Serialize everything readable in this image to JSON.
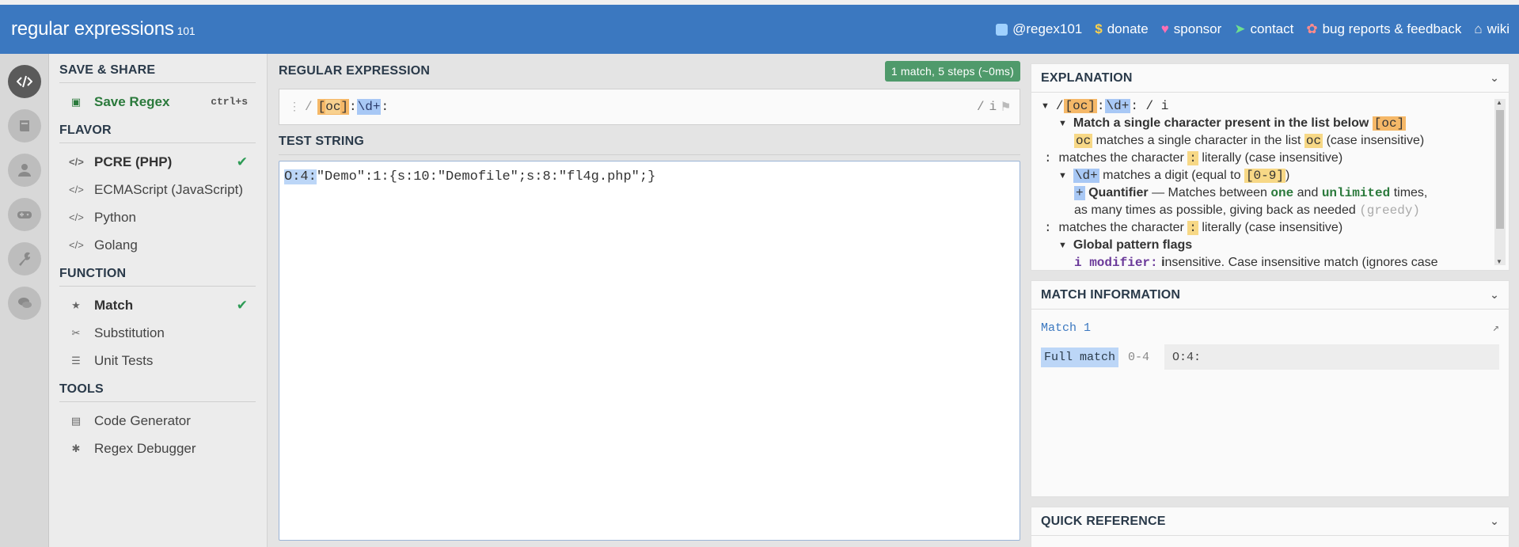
{
  "header": {
    "logo": "regular expressions",
    "version": "101",
    "nav": [
      {
        "label": "@regex101",
        "icon": "twitter-icon"
      },
      {
        "label": "donate",
        "icon": "dollar-icon"
      },
      {
        "label": "sponsor",
        "icon": "heart-icon"
      },
      {
        "label": "contact",
        "icon": "paper-plane-icon"
      },
      {
        "label": "bug reports & feedback",
        "icon": "bug-icon"
      },
      {
        "label": "wiki",
        "icon": "bank-icon"
      }
    ]
  },
  "sidebar": {
    "save_share": {
      "title": "SAVE & SHARE",
      "save_label": "Save Regex",
      "save_shortcut": "ctrl+s"
    },
    "flavor": {
      "title": "FLAVOR",
      "items": [
        "PCRE (PHP)",
        "ECMAScript (JavaScript)",
        "Python",
        "Golang"
      ],
      "selected": "PCRE (PHP)"
    },
    "function": {
      "title": "FUNCTION",
      "items": [
        "Match",
        "Substitution",
        "Unit Tests"
      ],
      "selected": "Match"
    },
    "tools": {
      "title": "TOOLS",
      "items": [
        "Code Generator",
        "Regex Debugger"
      ]
    }
  },
  "main": {
    "regex_title": "REGULAR EXPRESSION",
    "match_badge": "1 match, 5 steps (~0ms)",
    "regex": {
      "open_delim": "/",
      "class_open": "[",
      "class_body": "oc",
      "class_close": "]",
      "colon1": ":",
      "digit": "\\d+",
      "colon2": ":",
      "close_delim": "/",
      "flags": "i"
    },
    "test_title": "TEST STRING",
    "test_match": "O:4:",
    "test_rest": "\"Demo\":1:{s:10:\"Demofile\";s:8:\"fl4g.php\";}"
  },
  "explanation": {
    "title": "EXPLANATION",
    "root": {
      "pre": "/ ",
      "cls": "[oc]",
      "c1": ":",
      "dig": "\\d+",
      "c2": ": / i"
    },
    "l1": {
      "bold": "Match a single character present in the list below",
      "code": "[oc]"
    },
    "l2": {
      "code": "oc",
      "text": "matches a single character in the list",
      "code2": "oc",
      "tail": "(case insensitive)"
    },
    "l3": {
      "pre": ":",
      "text": "matches the character",
      "code": ":",
      "tail": "literally (case insensitive)"
    },
    "l4": {
      "code": "\\d+",
      "text": "matches a digit (equal to",
      "code2": "[0-9]",
      "tail": ")"
    },
    "l5": {
      "code": "+",
      "bold": "Quantifier",
      "text": "— Matches between",
      "one": "one",
      "and": "and",
      "unl": "unlimited",
      "tail": "times,"
    },
    "l6": {
      "text": "as many times as possible, giving back as needed",
      "greedy": "(greedy)"
    },
    "l7": {
      "pre": ":",
      "text": "matches the character",
      "code": ":",
      "tail": "literally (case insensitive)"
    },
    "l8": {
      "bold": "Global pattern flags"
    },
    "l9": {
      "mod": "i modifier:",
      "first": "i",
      "text": "nsensitive. Case insensitive match (ignores case"
    }
  },
  "match_info": {
    "title": "MATCH INFORMATION",
    "match_label": "Match 1",
    "full_label": "Full match",
    "range": "0-4",
    "value": "O:4:"
  },
  "quick_reference": {
    "title": "QUICK REFERENCE"
  }
}
